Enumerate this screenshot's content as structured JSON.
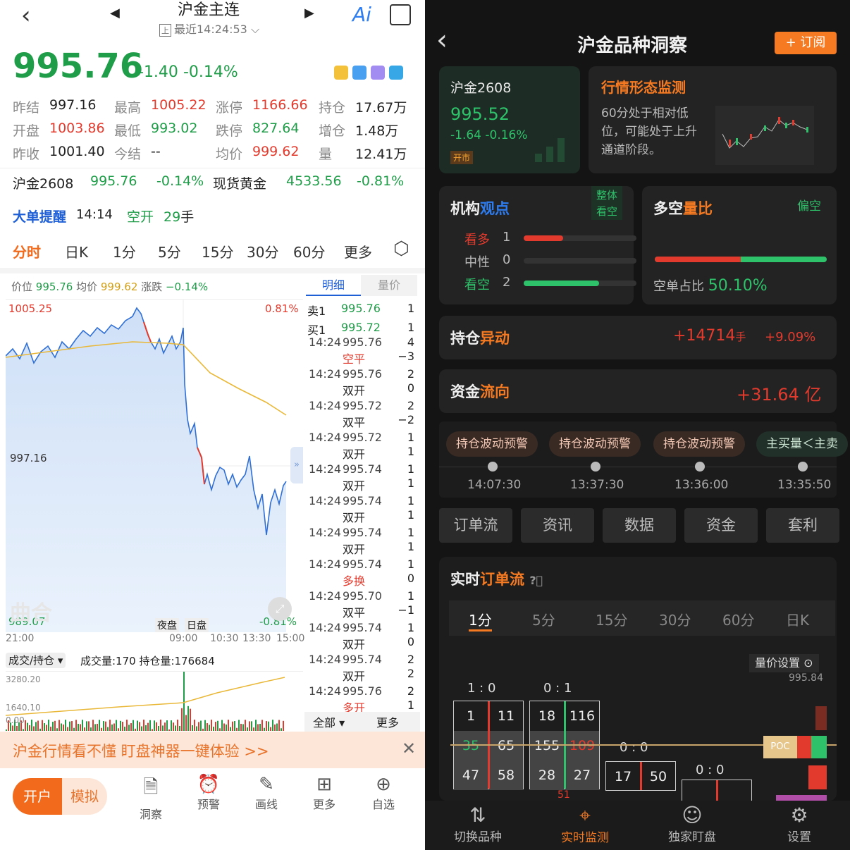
{
  "left": {
    "title": "沪金主连",
    "update": "最近14:24:53",
    "ai": "Ai",
    "price": "995.76",
    "change": "-1.40",
    "change_pct": "-0.14%",
    "stats": [
      {
        "l": "昨结",
        "v": "997.16",
        "c": "dark"
      },
      {
        "l": "最高",
        "v": "1005.22",
        "c": "red"
      },
      {
        "l": "涨停",
        "v": "1166.66",
        "c": "red"
      },
      {
        "l": "持仓",
        "v": "17.67万",
        "c": "dark"
      },
      {
        "l": "开盘",
        "v": "1003.86",
        "c": "red"
      },
      {
        "l": "最低",
        "v": "993.02",
        "c": "green"
      },
      {
        "l": "跌停",
        "v": "827.64",
        "c": "green"
      },
      {
        "l": "增仓",
        "v": "1.48万",
        "c": "dark"
      },
      {
        "l": "昨收",
        "v": "1001.40",
        "c": "dark"
      },
      {
        "l": "今结",
        "v": "--",
        "c": "dark"
      },
      {
        "l": "均价",
        "v": "999.62",
        "c": "red"
      },
      {
        "l": "量",
        "v": "12.41万",
        "c": "dark"
      }
    ],
    "ref1_name": "沪金2608",
    "ref1_price": "995.76",
    "ref1_pct": "-0.14%",
    "ref2_name": "现货黄金",
    "ref2_price": "4533.56",
    "ref2_pct": "-0.81%",
    "alert_label": "大单提醒",
    "alert_time": "14:14",
    "alert_type": "空开",
    "alert_qty": "29",
    "alert_unit": "手",
    "periods": [
      "分时",
      "日K",
      "1分",
      "5分",
      "15分",
      "30分",
      "60分",
      "更多"
    ],
    "legend": {
      "p_lbl": "价位",
      "p": "995.76",
      "a_lbl": "均价",
      "a": "999.62",
      "c_lbl": "涨跌",
      "c": "−0.14%"
    },
    "chart": {
      "hi": "1005.25",
      "hi_pct": "0.81%",
      "mid": "997.16",
      "lo": "989.07",
      "lo_pct": "-0.81%",
      "xt": [
        "21:00",
        "09:00",
        "10:30",
        "13:30",
        "15:00"
      ],
      "night": "夜盘",
      "day": "日盘",
      "wm": "曲合"
    },
    "vol": {
      "sel": "成交/持仓",
      "info": "成交量:170 持仓量:176684",
      "y1": "3280.20",
      "y2": "1640.10",
      "y3": "0.00"
    },
    "tabs": {
      "a": "明细",
      "b": "量价"
    },
    "quotes": [
      {
        "s": "卖1",
        "p": "995.76",
        "q": "1"
      },
      {
        "s": "买1",
        "p": "995.72",
        "q": "1"
      }
    ],
    "trades": [
      {
        "t": "14:24",
        "p": "995.76",
        "q": "4",
        "ty": "空平",
        "d": "−3",
        "c": "red"
      },
      {
        "t": "14:24",
        "p": "995.76",
        "q": "2",
        "ty": "双开",
        "d": "0",
        "c": "dark"
      },
      {
        "t": "14:24",
        "p": "995.72",
        "q": "2",
        "ty": "双平",
        "d": "−2",
        "c": "dark"
      },
      {
        "t": "14:24",
        "p": "995.72",
        "q": "1",
        "ty": "双开",
        "d": "1",
        "c": "dark"
      },
      {
        "t": "14:24",
        "p": "995.74",
        "q": "1",
        "ty": "双开",
        "d": "1",
        "c": "dark"
      },
      {
        "t": "14:24",
        "p": "995.74",
        "q": "1",
        "ty": "双开",
        "d": "1",
        "c": "dark"
      },
      {
        "t": "14:24",
        "p": "995.74",
        "q": "1",
        "ty": "双开",
        "d": "1",
        "c": "dark"
      },
      {
        "t": "14:24",
        "p": "995.74",
        "q": "1",
        "ty": "多换",
        "d": "0",
        "c": "red"
      },
      {
        "t": "14:24",
        "p": "995.70",
        "q": "1",
        "ty": "双平",
        "d": "−1",
        "c": "dark"
      },
      {
        "t": "14:24",
        "p": "995.74",
        "q": "1",
        "ty": "双开",
        "d": "0",
        "c": "dark"
      },
      {
        "t": "14:24",
        "p": "995.74",
        "q": "2",
        "ty": "双开",
        "d": "2",
        "c": "dark"
      },
      {
        "t": "14:24",
        "p": "995.76",
        "q": "2",
        "ty": "多开",
        "d": "1",
        "c": "red"
      }
    ],
    "tbl_all": "全部",
    "tbl_more": "更多",
    "promo": "沪金行情看不懂  盯盘神器一键体验 >>",
    "btn_open": "开户",
    "btn_sim": "模拟",
    "nav": [
      "洞察",
      "预警",
      "画线",
      "更多",
      "自选"
    ]
  },
  "right": {
    "title": "沪金品种洞察",
    "subscribe": "+ 订阅",
    "contract": "沪金2608",
    "c_price": "995.52",
    "c_change": "-1.64 -0.16%",
    "c_badge": "开市",
    "monitor_title": "行情形态监测",
    "monitor_text": "60分处于相对低位，可能处于上升通道阶段。",
    "inst_title_a": "机构",
    "inst_title_b": "观点",
    "inst_tag": "整体看空",
    "inst": [
      {
        "l": "看多",
        "n": "1",
        "pct": 0.35
      },
      {
        "l": "中性",
        "n": "0",
        "pct": 0
      },
      {
        "l": "看空",
        "n": "2",
        "pct": 0.67
      }
    ],
    "ls_title_a": "多空",
    "ls_title_b": "量比",
    "ls_tag": "偏空",
    "ls_label": "空单占比",
    "ls_value": "50.10%",
    "ls_short_fraction": 0.499,
    "pos_title_a": "持仓",
    "pos_title_b": "异动",
    "pos_val": "+14714",
    "pos_unit": "手",
    "pos_pct": "+9.09%",
    "flow_title_a": "资金",
    "flow_title_b": "流向",
    "flow_val": "+31.64 亿",
    "pills": [
      {
        "txt": "持仓波动预警",
        "time": "14:07:30"
      },
      {
        "txt": "持仓波动预警",
        "time": "13:37:30"
      },
      {
        "txt": "持仓波动预警",
        "time": "13:36:00"
      },
      {
        "txt": "主买量＜主卖",
        "time": "13:35:50"
      }
    ],
    "segs": [
      "订单流",
      "资讯",
      "数据",
      "资金",
      "套利"
    ],
    "of_title_a": "实时",
    "of_title_b": "订单流",
    "of_periods": [
      "1分",
      "5分",
      "15分",
      "30分",
      "60分",
      "日K"
    ],
    "of_setting": "量价设置",
    "of_price": "995.84",
    "poc": "POC",
    "cols": [
      {
        "hdr": "1 : 0",
        "rows": [
          [
            "1",
            "11"
          ],
          [
            "35",
            "65"
          ],
          [
            "47",
            "58"
          ]
        ]
      },
      {
        "hdr": "0 : 1",
        "rows": [
          [
            "18",
            "116"
          ],
          [
            "155",
            "109"
          ],
          [
            "28",
            "27"
          ]
        ],
        "foot": "51"
      },
      {
        "hdr": "0 : 0",
        "rows": [
          [
            "17",
            "50"
          ]
        ]
      },
      {
        "hdr": "0 : 0",
        "rows": []
      }
    ],
    "nav": [
      "切换品种",
      "实时监测",
      "独家盯盘",
      "设置"
    ]
  }
}
